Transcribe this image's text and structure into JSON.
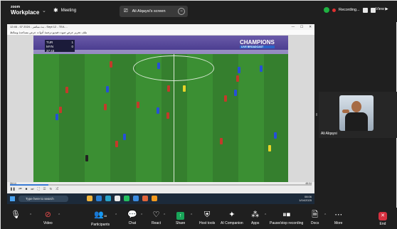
{
  "topbar": {
    "logo_top": "zoom",
    "logo_main": "Workplace",
    "meeting_label": "Meeting",
    "share_label": "Ali Alqaysi's screen",
    "recording_label": "Recording...",
    "view_label": "View"
  },
  "shared_window": {
    "title": "12:46 - 07 بث مباشر - 2024 - Sept 12 - TEA ...",
    "controls": [
      "—",
      "☐",
      "✕"
    ],
    "menu": "ملف  تحرير  عرض  صوت  فيديو  ترجمة  أدوات  عرض  مساعدة  وسائط",
    "score": {
      "team1": "TUR",
      "score1": "1",
      "team2": "MYN",
      "score2": "0",
      "clock": "37:43"
    },
    "brand": "CHAMPIONS",
    "brand_sub": "LIVE BROADCAST",
    "time_elapsed": "06:14",
    "time_total": "48:04",
    "search_placeholder": "Type here to search",
    "tray_time": "08:06",
    "tray_date": "1/04/2025"
  },
  "participant": {
    "name": "Ali Alqaysi"
  },
  "toolbar": {
    "audio": "",
    "video": "Video",
    "participants": "Participants",
    "participants_count": "16",
    "chat": "Chat",
    "react": "React",
    "share": "Share",
    "host_tools": "Host tools",
    "ai_companion": "AI Companion",
    "apps": "Apps",
    "pause_recording": "Pause/stop recording",
    "docs": "Docs",
    "more": "More",
    "end": "End"
  }
}
